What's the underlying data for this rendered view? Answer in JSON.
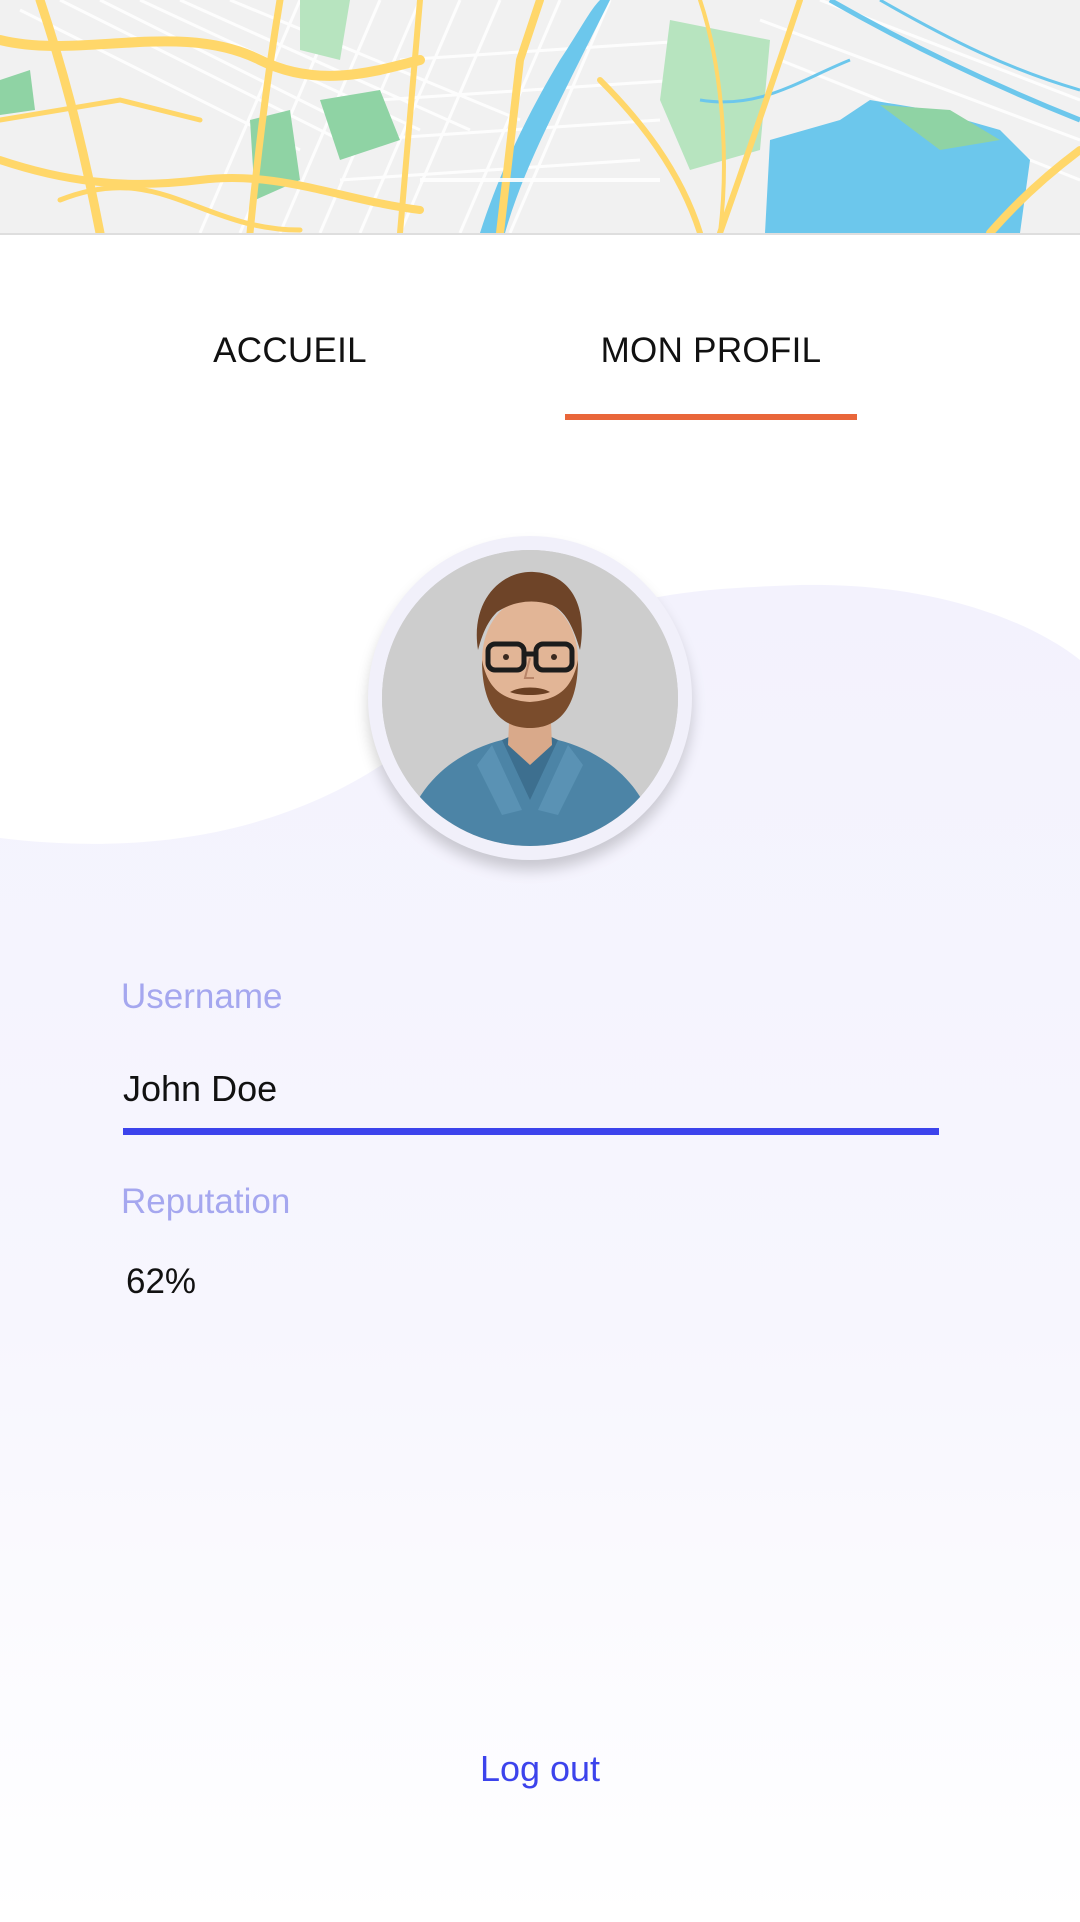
{
  "tabs": [
    {
      "label": "ACCUEIL",
      "active": false
    },
    {
      "label": "MON PROFIL",
      "active": true
    }
  ],
  "profile": {
    "avatar_description": "profile photo",
    "fields": {
      "username": {
        "label": "Username",
        "value": "John Doe"
      },
      "reputation": {
        "label": "Reputation",
        "value": "62%"
      }
    },
    "logout_label": "Log out"
  },
  "colors": {
    "tab_indicator": "#e9663a",
    "accent": "#3c43ec",
    "field_label": "#a5a7ef",
    "wave_background": "#f4f3fd",
    "map_road": "#ffd76a",
    "map_park": "#8fd3a4",
    "map_water": "#6cc7ec"
  }
}
